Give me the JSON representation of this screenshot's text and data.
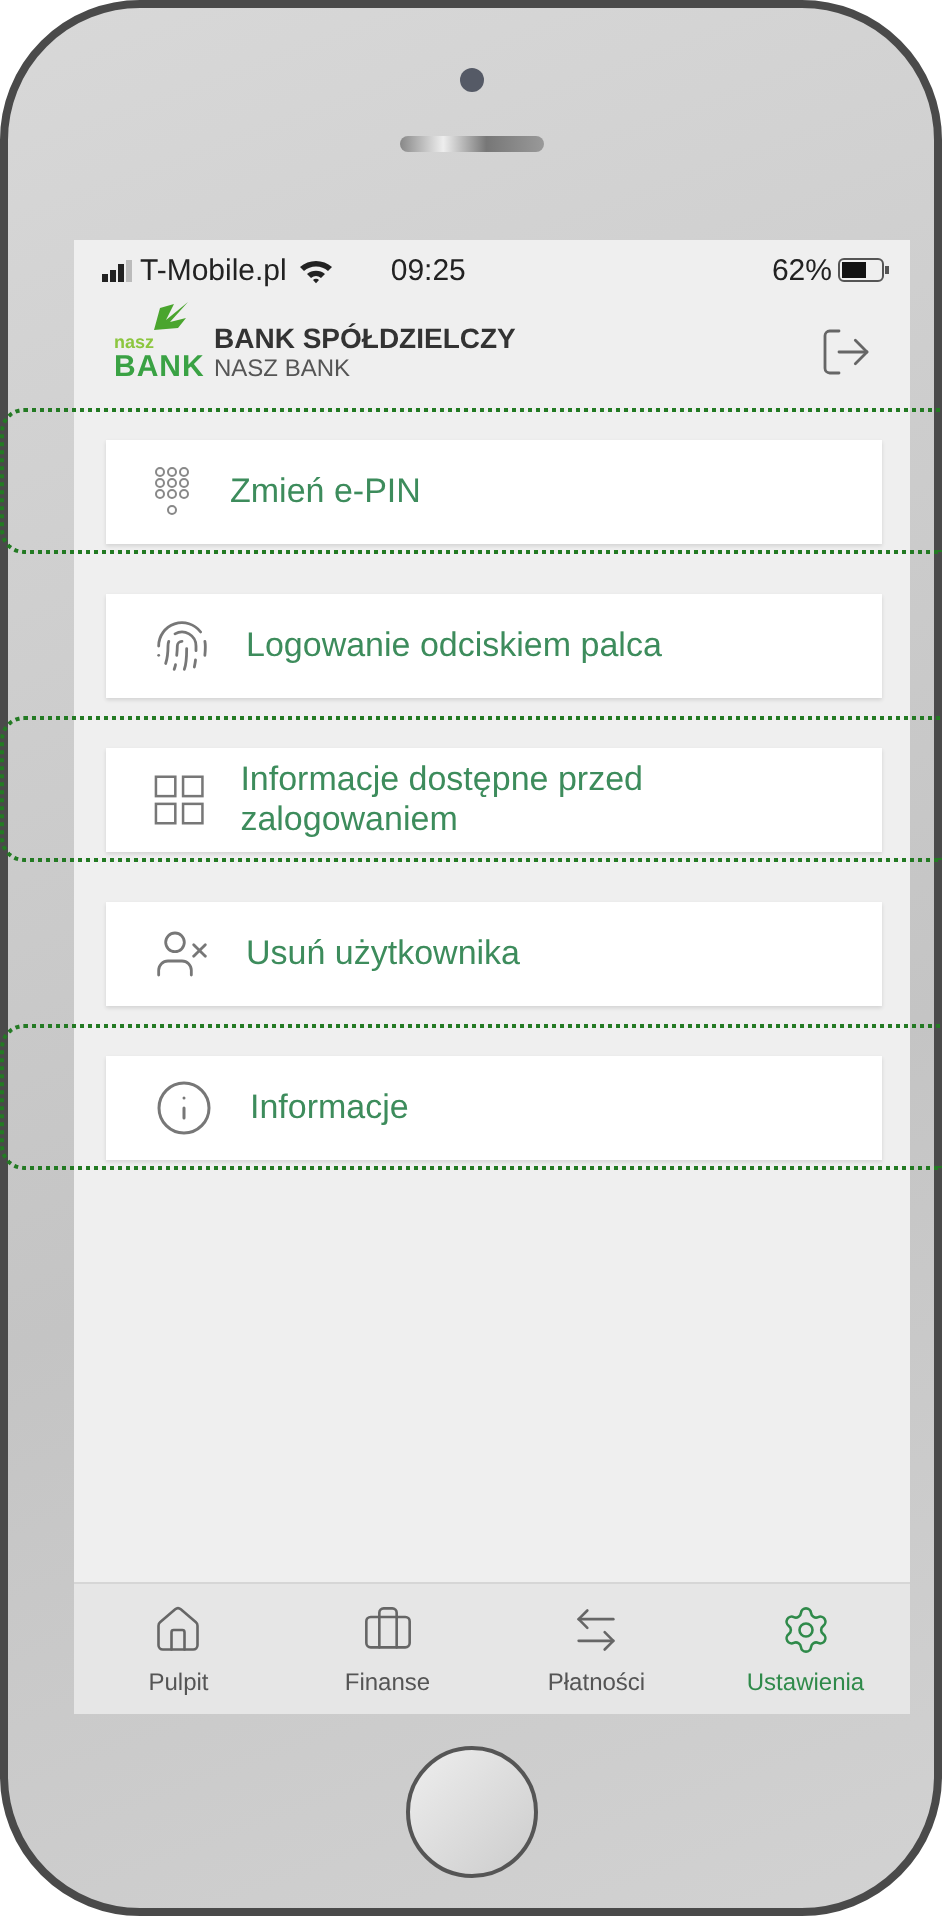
{
  "status_bar": {
    "carrier": "T-Mobile.pl",
    "time": "09:25",
    "battery": "62%"
  },
  "header": {
    "logo_small": "nasz",
    "logo_big": "BANK",
    "title": "BANK SPÓŁDZIELCZY",
    "subtitle": "NASZ BANK"
  },
  "menu": [
    {
      "kind": "keypad",
      "label": "Zmień e-PIN",
      "highlighted": true
    },
    {
      "kind": "fingerprint",
      "label": "Logowanie odciskiem palca",
      "highlighted": false
    },
    {
      "kind": "grid",
      "label": "Informacje dostępne przed zalogowaniem",
      "highlighted": true
    },
    {
      "kind": "user-remove",
      "label": "Usuń użytkownika",
      "highlighted": false
    },
    {
      "kind": "info",
      "label": "Informacje",
      "highlighted": true
    }
  ],
  "tabs": [
    {
      "kind": "home",
      "label": "Pulpit",
      "selected": false
    },
    {
      "kind": "briefcase",
      "label": "Finanse",
      "selected": false
    },
    {
      "kind": "transfer",
      "label": "Płatności",
      "selected": false
    },
    {
      "kind": "settings",
      "label": "Ustawienia",
      "selected": true
    }
  ]
}
